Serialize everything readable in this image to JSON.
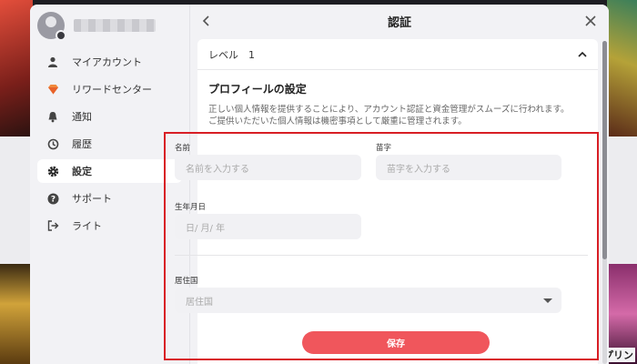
{
  "background": {
    "bottom_right_label": "プリン"
  },
  "header": {
    "title": "認証"
  },
  "sidebar": {
    "items": [
      {
        "label": "マイアカウント",
        "icon": "user-icon"
      },
      {
        "label": "リワードセンター",
        "icon": "gem-icon"
      },
      {
        "label": "通知",
        "icon": "bell-icon"
      },
      {
        "label": "履歴",
        "icon": "history-icon"
      },
      {
        "label": "設定",
        "icon": "gear-icon",
        "active": true
      },
      {
        "label": "サポート",
        "icon": "help-icon"
      },
      {
        "label": "ライト",
        "icon": "logout-icon"
      }
    ]
  },
  "card": {
    "level": "レベル　1",
    "title": "プロフィールの設定",
    "description_line1": "正しい個人情報を提供することにより、アカウント認証と資金管理がスムーズに行われます。",
    "description_line2": "ご提供いただいた個人情報は機密事項として厳重に管理されます。"
  },
  "form": {
    "first_name": {
      "label": "名前",
      "placeholder": "名前を入力する"
    },
    "last_name": {
      "label": "苗字",
      "placeholder": "苗字を入力する"
    },
    "birthdate": {
      "label": "生年月日",
      "placeholder": "日/ 月/ 年"
    },
    "country": {
      "label": "居住国",
      "placeholder": "居住国"
    },
    "save_label": "保存"
  },
  "colors": {
    "accent": "#f0565c",
    "highlight_border": "#d81e25"
  }
}
